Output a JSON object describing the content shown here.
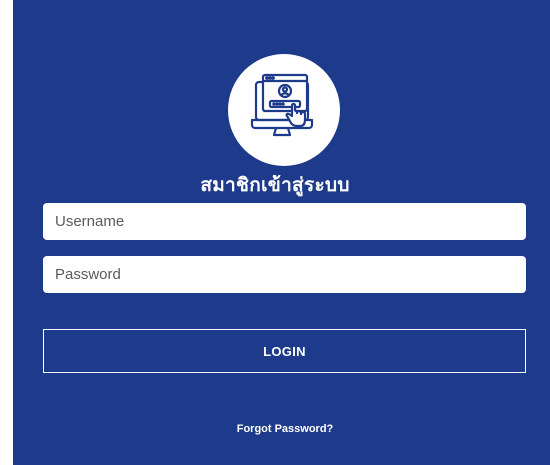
{
  "login_panel": {
    "logo_icon": "computer-user-login-icon",
    "title": "สมาชิกเข้าสู่ระบบ",
    "username_placeholder": "Username",
    "username_value": "",
    "password_placeholder": "Password",
    "password_value": "",
    "login_label": "LOGIN",
    "forgot_label": "Forgot Password?"
  },
  "colors": {
    "panel_background": "#1e3a8a",
    "logo_background": "#ffffff",
    "text": "#ffffff"
  }
}
